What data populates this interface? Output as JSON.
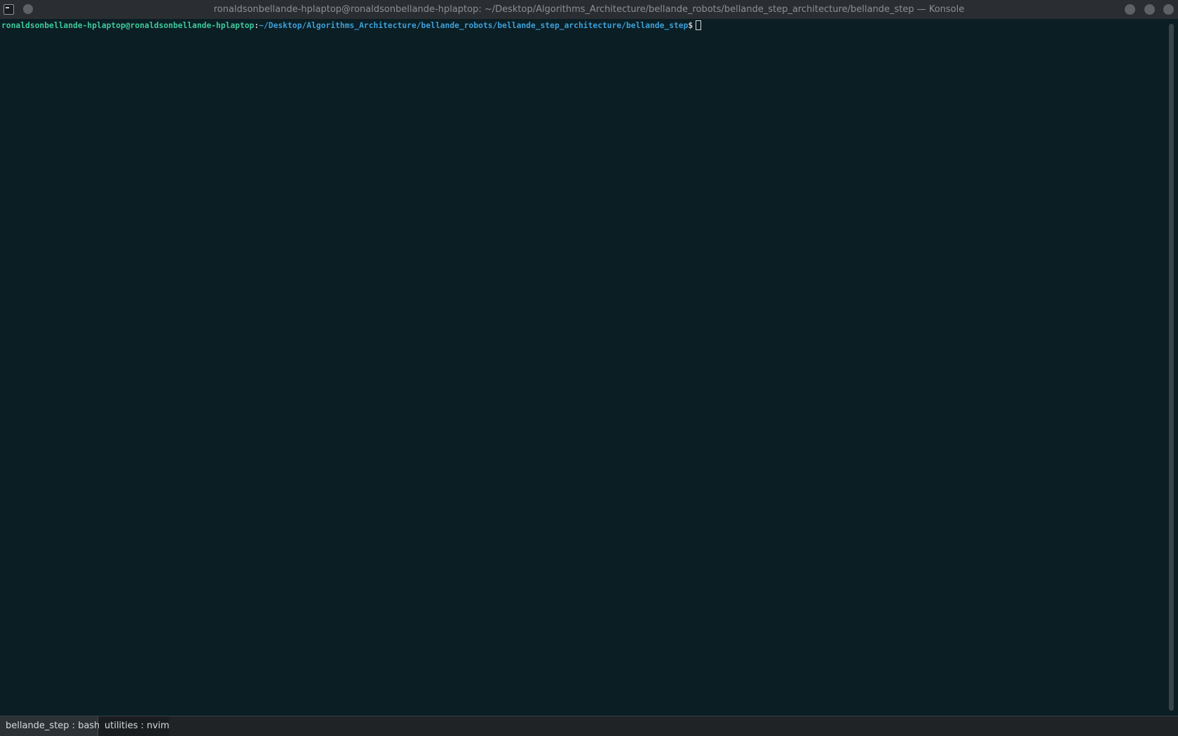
{
  "window": {
    "title": "ronaldsonbellande-hplaptop@ronaldsonbellande-hplaptop: ~/Desktop/Algorithms_Architecture/bellande_robots/bellande_step_architecture/bellande_step — Konsole",
    "icon": "terminal-icon"
  },
  "terminal": {
    "prompt_user": "ronaldsonbellande-hplaptop@ronaldsonbellande-hplaptop",
    "prompt_sep": ":",
    "prompt_path": "~/Desktop/Algorithms_Architecture/bellande_robots/bellande_step_architecture/bellande_step",
    "prompt_symbol": "$",
    "colors": {
      "background": "#0a1e24",
      "user": "#3fc79a",
      "path": "#3e9ed6"
    }
  },
  "tabs": [
    {
      "label": "bellande_step : bash",
      "active": true
    },
    {
      "label": "utilities : nvim",
      "active": false
    }
  ]
}
